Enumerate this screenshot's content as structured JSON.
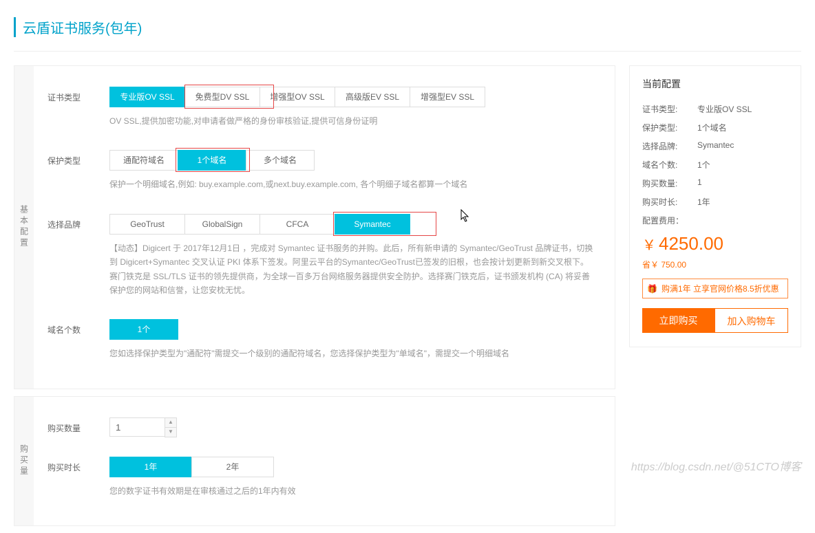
{
  "page": {
    "title": "云盾证书服务(包年)",
    "watermark": "https://blog.csdn.net/@51CTO博客"
  },
  "sideTabs": {
    "basic": "基本配置",
    "purchase": "购买量"
  },
  "labels": {
    "certType": "证书类型",
    "protectType": "保护类型",
    "brand": "选择品牌",
    "domainCount": "域名个数",
    "qty": "购买数量",
    "duration": "购买时长"
  },
  "certType": {
    "options": [
      "专业版OV SSL",
      "免费型DV SSL",
      "增强型OV SSL",
      "高级版EV SSL",
      "增强型EV SSL"
    ],
    "selected": 0,
    "desc": "OV SSL,提供加密功能,对申请者做严格的身份审核验证,提供可信身份证明"
  },
  "protectType": {
    "options": [
      "通配符域名",
      "1个域名",
      "多个域名"
    ],
    "selected": 1,
    "desc": "保护一个明细域名,例如: buy.example.com,或next.buy.example.com, 各个明细子域名都算一个域名"
  },
  "brand": {
    "options": [
      "GeoTrust",
      "GlobalSign",
      "CFCA",
      "Symantec"
    ],
    "selected": 3,
    "desc": "【动态】Digicert 于 2017年12月1日 ，完成对 Symantec 证书服务的并购。此后，所有新申请的 Symantec/GeoTrust 品牌证书，切换到 Digicert+Symantec 交叉认证 PKI 体系下签发。阿里云平台的Symantec/GeoTrust已签发的旧根，也会按计划更新到新交叉根下。\n赛门铁克是 SSL/TLS 证书的领先提供商，为全球一百多万台网络服务器提供安全防护。选择赛门铁克后，证书颁发机构 (CA) 将妥善保护您的网站和信誉，让您安枕无忧。"
  },
  "domainCount": {
    "options": [
      "1个"
    ],
    "selected": 0,
    "desc": "您如选择保护类型为\"通配符\"需提交一个级别的通配符域名，您选择保护类型为\"单域名\"，需提交一个明细域名"
  },
  "qty": {
    "value": "1"
  },
  "duration": {
    "options": [
      "1年",
      "2年"
    ],
    "selected": 0,
    "desc": "您的数字证书有效期是在审核通过之后的1年内有效"
  },
  "config": {
    "title": "当前配置",
    "rows": [
      {
        "k": "证书类型:",
        "v": "专业版OV SSL"
      },
      {
        "k": "保护类型:",
        "v": "1个域名"
      },
      {
        "k": "选择品牌:",
        "v": "Symantec"
      },
      {
        "k": "域名个数:",
        "v": "1个"
      },
      {
        "k": "购买数量:",
        "v": "1"
      },
      {
        "k": "购买时长:",
        "v": "1年"
      }
    ],
    "feeLabel": "配置费用：",
    "currency": "￥",
    "price": "4250.00",
    "saveLabel": "省￥ 750.00",
    "promo": "购满1年 立享官网价格8.5折优惠",
    "buyNow": "立即购买",
    "addCart": "加入购物车"
  }
}
